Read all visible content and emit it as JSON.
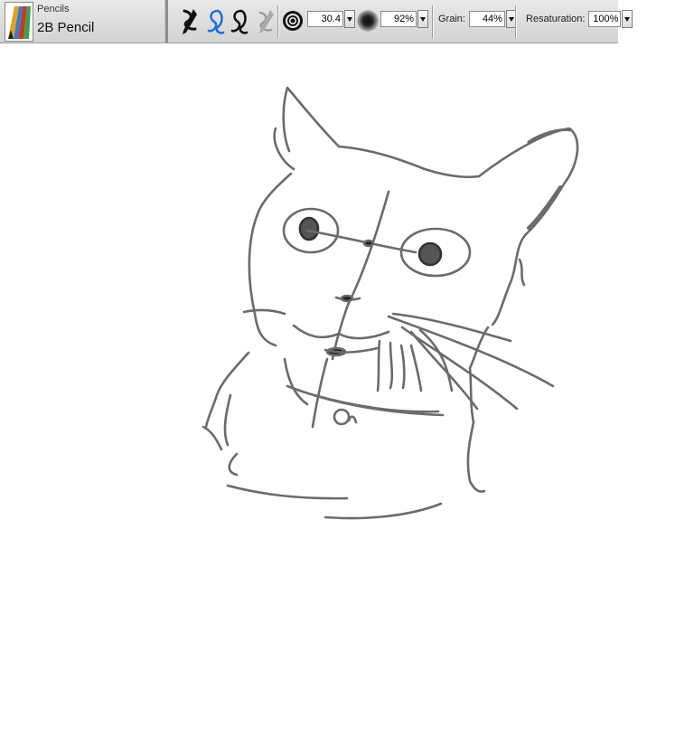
{
  "brush": {
    "category": "Pencils",
    "variant": "2B Pencil"
  },
  "properties": {
    "size": "30.4",
    "opacity": "92%",
    "grain_label": "Grain:",
    "grain": "44%",
    "resaturation_label": "Resaturation:",
    "resaturation": "100%"
  },
  "icons": {
    "brush_thumb": "pencil-brush-icon",
    "stroke_type": "freehand-brush-icon",
    "freehand": "freehand-stroke-icon",
    "straight": "straight-line-stroke-icon",
    "dab": "brush-tracking-icon",
    "size": "size-icon",
    "opacity": "opacity-icon"
  },
  "colors": {
    "toolbar_bg": "#d9d9d9",
    "accent_blue": "#1e73d8",
    "stroke": "#6b6b6b",
    "canvas": "#ffffff"
  }
}
